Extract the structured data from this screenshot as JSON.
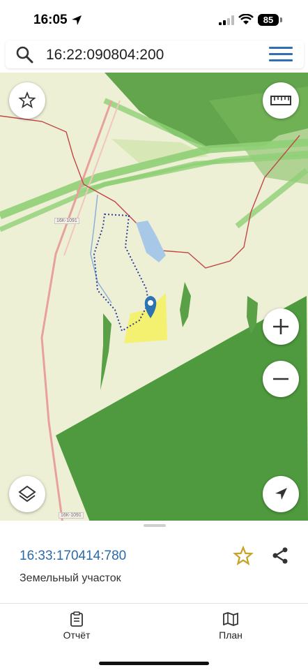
{
  "status_bar": {
    "time": "16:05",
    "battery": "85"
  },
  "search": {
    "query": "16:22:090804:200"
  },
  "map": {
    "road_labels": [
      "16К-1091",
      "16К-1091"
    ],
    "controls": {
      "favorite": "star-icon",
      "ruler": "ruler-icon",
      "zoom_in": "+",
      "zoom_out": "−",
      "layers": "layers-icon",
      "locate": "navigation-arrow-icon"
    },
    "colors": {
      "forest": "#4f9a3e",
      "parcel": "#f4f06a",
      "marker": "#2b73b3",
      "boundary": "#b23a3a"
    }
  },
  "sheet": {
    "cadastral_number": "16:33:170414:780",
    "property_type": "Земельный участок"
  },
  "tabs": [
    {
      "label": "Отчёт",
      "icon": "clipboard-icon"
    },
    {
      "label": "План",
      "icon": "map-icon"
    }
  ]
}
